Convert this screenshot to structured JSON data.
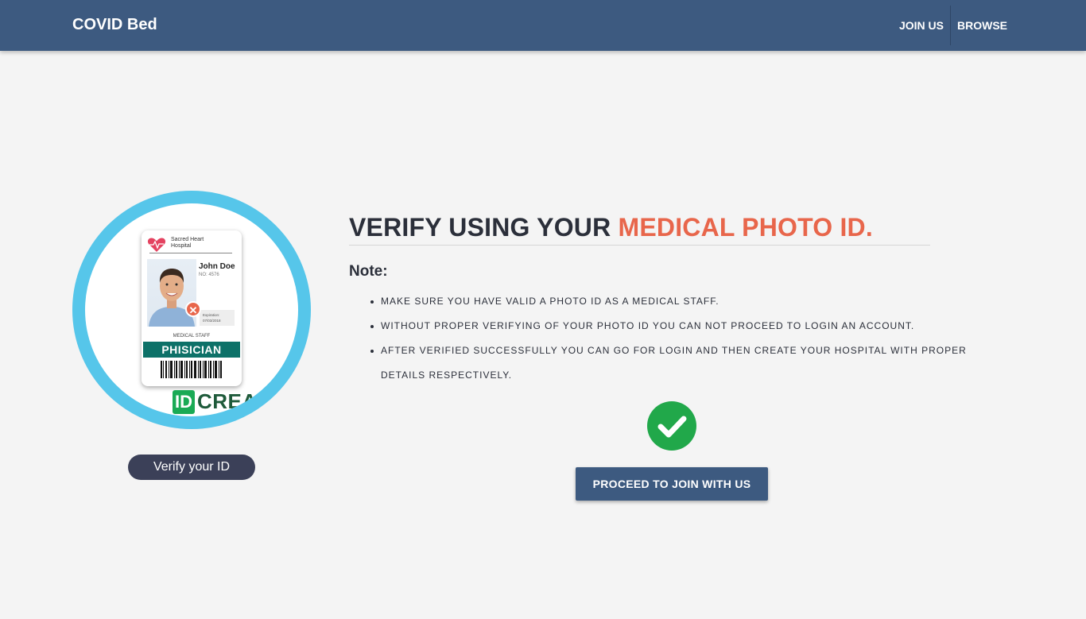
{
  "navbar": {
    "brand": "COVID Bed",
    "links": [
      {
        "label": "JOIN US"
      },
      {
        "label": "BROWSE"
      }
    ],
    "background": "#3d5a80"
  },
  "id_card_image": {
    "hospital_name": "Sacred Heart Hospital",
    "person_name": "John Doe",
    "number": "NO: 4576",
    "expiration_label": "Expiration:",
    "expiration_date": "07/03/2018",
    "staff_label": "MEDICAL STAFF",
    "role": "PHISICIAN",
    "watermark_box": "ID",
    "watermark_text": "CREA",
    "ring_color": "#56c6ea",
    "status_icon": "x-circle-icon"
  },
  "verify_button": {
    "label": "Verify your ID"
  },
  "main": {
    "heading_prefix": "VERIFY USING YOUR ",
    "heading_accent": "MEDICAL PHOTO ID.",
    "accent_color": "#e8664b",
    "note_label": "Note:",
    "notes": [
      "MAKE SURE YOU HAVE VALID A PHOTO ID AS A MEDICAL STAFF.",
      "WITHOUT PROPER VERIFYING OF YOUR PHOTO ID YOU CAN NOT PROCEED TO LOGIN AN ACCOUNT.",
      "AFTER VERIFIED SUCCESSFULLY YOU CAN GO FOR LOGIN AND THEN CREATE YOUR HOSPITAL WITH PROPER DETAILS RESPECTIVELY."
    ],
    "status_icon": "check-circle-icon",
    "status_color": "#21a84a",
    "proceed_button": "PROCEED TO JOIN WITH US"
  }
}
